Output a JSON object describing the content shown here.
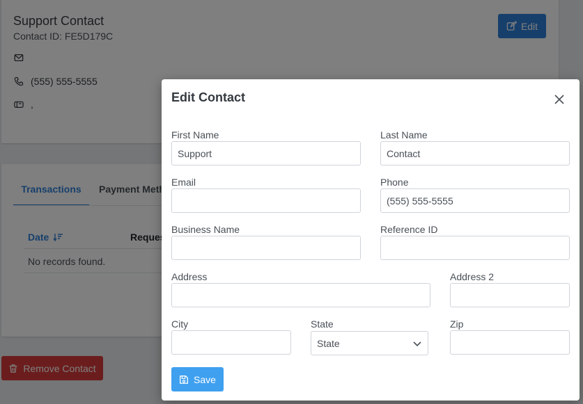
{
  "contact": {
    "name": "Support Contact",
    "contact_id": "Contact ID: FE5D179C",
    "email": "",
    "phone": "(555) 555-5555",
    "address": ","
  },
  "header": {
    "edit_label": "Edit"
  },
  "tabs": [
    {
      "label": "Transactions",
      "active": true
    },
    {
      "label": "Payment Meth",
      "active": false
    }
  ],
  "table": {
    "columns": [
      "Date",
      "Reques"
    ],
    "empty_text": "No records found."
  },
  "footer": {
    "remove_label": "Remove Contact"
  },
  "modal": {
    "title": "Edit Contact",
    "fields": {
      "first_name": {
        "label": "First Name",
        "value": "Support"
      },
      "last_name": {
        "label": "Last Name",
        "value": "Contact"
      },
      "email": {
        "label": "Email",
        "value": ""
      },
      "phone": {
        "label": "Phone",
        "value": "(555) 555-5555"
      },
      "business_name": {
        "label": "Business Name",
        "value": ""
      },
      "reference_id": {
        "label": "Reference ID",
        "value": ""
      },
      "address": {
        "label": "Address",
        "value": ""
      },
      "address2": {
        "label": "Address 2",
        "value": ""
      },
      "city": {
        "label": "City",
        "value": ""
      },
      "state": {
        "label": "State",
        "value": "State"
      },
      "zip": {
        "label": "Zip",
        "value": ""
      }
    },
    "save_label": "Save"
  },
  "colors": {
    "primary": "#2f7fd6",
    "danger": "#d63a3a",
    "save": "#3fa0f0"
  }
}
